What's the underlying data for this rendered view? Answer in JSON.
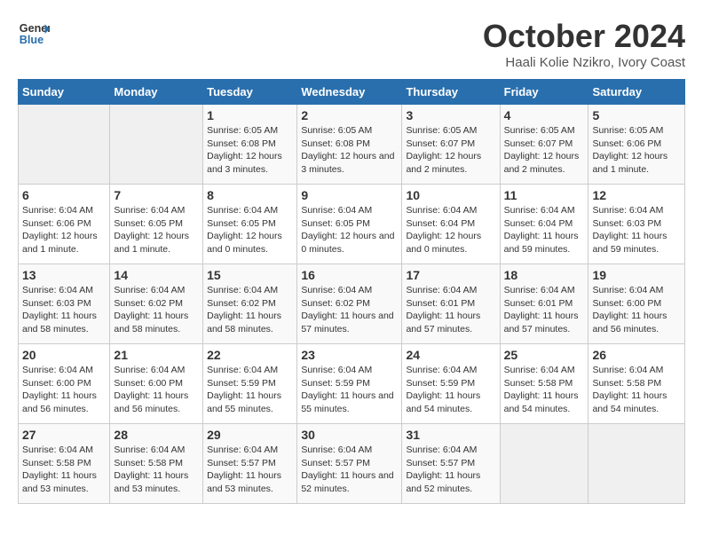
{
  "logo": {
    "text_general": "General",
    "text_blue": "Blue"
  },
  "header": {
    "month_title": "October 2024",
    "location": "Haali Kolie Nzikro, Ivory Coast"
  },
  "weekdays": [
    "Sunday",
    "Monday",
    "Tuesday",
    "Wednesday",
    "Thursday",
    "Friday",
    "Saturday"
  ],
  "weeks": [
    [
      {
        "day": "",
        "sunrise": "",
        "sunset": "",
        "daylight": ""
      },
      {
        "day": "",
        "sunrise": "",
        "sunset": "",
        "daylight": ""
      },
      {
        "day": "1",
        "sunrise": "Sunrise: 6:05 AM",
        "sunset": "Sunset: 6:08 PM",
        "daylight": "Daylight: 12 hours and 3 minutes."
      },
      {
        "day": "2",
        "sunrise": "Sunrise: 6:05 AM",
        "sunset": "Sunset: 6:08 PM",
        "daylight": "Daylight: 12 hours and 3 minutes."
      },
      {
        "day": "3",
        "sunrise": "Sunrise: 6:05 AM",
        "sunset": "Sunset: 6:07 PM",
        "daylight": "Daylight: 12 hours and 2 minutes."
      },
      {
        "day": "4",
        "sunrise": "Sunrise: 6:05 AM",
        "sunset": "Sunset: 6:07 PM",
        "daylight": "Daylight: 12 hours and 2 minutes."
      },
      {
        "day": "5",
        "sunrise": "Sunrise: 6:05 AM",
        "sunset": "Sunset: 6:06 PM",
        "daylight": "Daylight: 12 hours and 1 minute."
      }
    ],
    [
      {
        "day": "6",
        "sunrise": "Sunrise: 6:04 AM",
        "sunset": "Sunset: 6:06 PM",
        "daylight": "Daylight: 12 hours and 1 minute."
      },
      {
        "day": "7",
        "sunrise": "Sunrise: 6:04 AM",
        "sunset": "Sunset: 6:05 PM",
        "daylight": "Daylight: 12 hours and 1 minute."
      },
      {
        "day": "8",
        "sunrise": "Sunrise: 6:04 AM",
        "sunset": "Sunset: 6:05 PM",
        "daylight": "Daylight: 12 hours and 0 minutes."
      },
      {
        "day": "9",
        "sunrise": "Sunrise: 6:04 AM",
        "sunset": "Sunset: 6:05 PM",
        "daylight": "Daylight: 12 hours and 0 minutes."
      },
      {
        "day": "10",
        "sunrise": "Sunrise: 6:04 AM",
        "sunset": "Sunset: 6:04 PM",
        "daylight": "Daylight: 12 hours and 0 minutes."
      },
      {
        "day": "11",
        "sunrise": "Sunrise: 6:04 AM",
        "sunset": "Sunset: 6:04 PM",
        "daylight": "Daylight: 11 hours and 59 minutes."
      },
      {
        "day": "12",
        "sunrise": "Sunrise: 6:04 AM",
        "sunset": "Sunset: 6:03 PM",
        "daylight": "Daylight: 11 hours and 59 minutes."
      }
    ],
    [
      {
        "day": "13",
        "sunrise": "Sunrise: 6:04 AM",
        "sunset": "Sunset: 6:03 PM",
        "daylight": "Daylight: 11 hours and 58 minutes."
      },
      {
        "day": "14",
        "sunrise": "Sunrise: 6:04 AM",
        "sunset": "Sunset: 6:02 PM",
        "daylight": "Daylight: 11 hours and 58 minutes."
      },
      {
        "day": "15",
        "sunrise": "Sunrise: 6:04 AM",
        "sunset": "Sunset: 6:02 PM",
        "daylight": "Daylight: 11 hours and 58 minutes."
      },
      {
        "day": "16",
        "sunrise": "Sunrise: 6:04 AM",
        "sunset": "Sunset: 6:02 PM",
        "daylight": "Daylight: 11 hours and 57 minutes."
      },
      {
        "day": "17",
        "sunrise": "Sunrise: 6:04 AM",
        "sunset": "Sunset: 6:01 PM",
        "daylight": "Daylight: 11 hours and 57 minutes."
      },
      {
        "day": "18",
        "sunrise": "Sunrise: 6:04 AM",
        "sunset": "Sunset: 6:01 PM",
        "daylight": "Daylight: 11 hours and 57 minutes."
      },
      {
        "day": "19",
        "sunrise": "Sunrise: 6:04 AM",
        "sunset": "Sunset: 6:00 PM",
        "daylight": "Daylight: 11 hours and 56 minutes."
      }
    ],
    [
      {
        "day": "20",
        "sunrise": "Sunrise: 6:04 AM",
        "sunset": "Sunset: 6:00 PM",
        "daylight": "Daylight: 11 hours and 56 minutes."
      },
      {
        "day": "21",
        "sunrise": "Sunrise: 6:04 AM",
        "sunset": "Sunset: 6:00 PM",
        "daylight": "Daylight: 11 hours and 56 minutes."
      },
      {
        "day": "22",
        "sunrise": "Sunrise: 6:04 AM",
        "sunset": "Sunset: 5:59 PM",
        "daylight": "Daylight: 11 hours and 55 minutes."
      },
      {
        "day": "23",
        "sunrise": "Sunrise: 6:04 AM",
        "sunset": "Sunset: 5:59 PM",
        "daylight": "Daylight: 11 hours and 55 minutes."
      },
      {
        "day": "24",
        "sunrise": "Sunrise: 6:04 AM",
        "sunset": "Sunset: 5:59 PM",
        "daylight": "Daylight: 11 hours and 54 minutes."
      },
      {
        "day": "25",
        "sunrise": "Sunrise: 6:04 AM",
        "sunset": "Sunset: 5:58 PM",
        "daylight": "Daylight: 11 hours and 54 minutes."
      },
      {
        "day": "26",
        "sunrise": "Sunrise: 6:04 AM",
        "sunset": "Sunset: 5:58 PM",
        "daylight": "Daylight: 11 hours and 54 minutes."
      }
    ],
    [
      {
        "day": "27",
        "sunrise": "Sunrise: 6:04 AM",
        "sunset": "Sunset: 5:58 PM",
        "daylight": "Daylight: 11 hours and 53 minutes."
      },
      {
        "day": "28",
        "sunrise": "Sunrise: 6:04 AM",
        "sunset": "Sunset: 5:58 PM",
        "daylight": "Daylight: 11 hours and 53 minutes."
      },
      {
        "day": "29",
        "sunrise": "Sunrise: 6:04 AM",
        "sunset": "Sunset: 5:57 PM",
        "daylight": "Daylight: 11 hours and 53 minutes."
      },
      {
        "day": "30",
        "sunrise": "Sunrise: 6:04 AM",
        "sunset": "Sunset: 5:57 PM",
        "daylight": "Daylight: 11 hours and 52 minutes."
      },
      {
        "day": "31",
        "sunrise": "Sunrise: 6:04 AM",
        "sunset": "Sunset: 5:57 PM",
        "daylight": "Daylight: 11 hours and 52 minutes."
      },
      {
        "day": "",
        "sunrise": "",
        "sunset": "",
        "daylight": ""
      },
      {
        "day": "",
        "sunrise": "",
        "sunset": "",
        "daylight": ""
      }
    ]
  ]
}
